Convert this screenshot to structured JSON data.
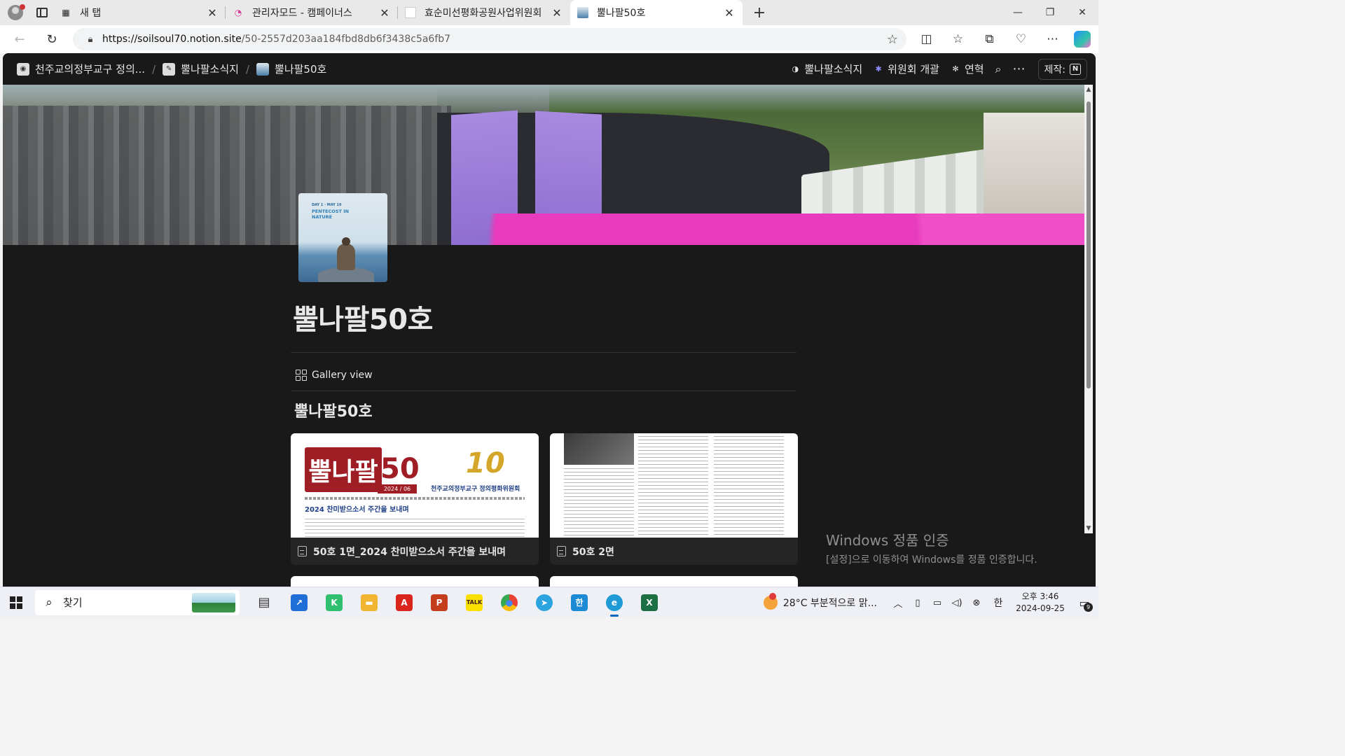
{
  "browser": {
    "tabs": [
      {
        "title": "새 탭",
        "icon": "new-tab-page-icon",
        "active": false
      },
      {
        "title": "관리자모드 - 캠페이너스",
        "icon": "campaigners-icon",
        "active": false
      },
      {
        "title": "효순미선평화공원사업위원회",
        "icon": "blank-page-icon",
        "active": false
      },
      {
        "title": "뿔나팔50호",
        "icon": "notion-page-icon",
        "active": true
      }
    ],
    "url_host": "https://soilsoul70.notion.site",
    "url_path": "/50-2557d203aa184fbd8db6f3438c5a6fb7"
  },
  "notion": {
    "breadcrumbs": [
      {
        "label": "천주교의정부교구 정의...",
        "icon": "org-logo-icon"
      },
      {
        "label": "뿔나팔소식지",
        "icon": "newsletter-icon"
      },
      {
        "label": "뿔나팔50호",
        "icon": "page-cover-icon"
      }
    ],
    "top_links": [
      {
        "label": "뿔나팔소식지",
        "icon": "newsletter-icon"
      },
      {
        "label": "위원회 개괄",
        "icon": "committee-icon"
      },
      {
        "label": "연혁",
        "icon": "history-icon"
      }
    ],
    "made_with_label": "제작:",
    "page_icon": {
      "line1": "DAY 1 · MAY 19",
      "line2": "PENTECOST IN NATURE"
    },
    "page_title": "뿔나팔50호",
    "view_label": "Gallery view",
    "database_title": "뿔나팔50호",
    "cards": [
      {
        "title": "50호 1면_2024 찬미받으소서 주간을 보내며",
        "thumb": {
          "logo_text": "뿔나팔",
          "issue": "50",
          "date": "2024 / 06",
          "org": "천주교의정부교구 정의평화위원회",
          "headline": "2024 찬미받으소서 주간을 보내며"
        }
      },
      {
        "title": "50호 2면"
      }
    ]
  },
  "watermark": {
    "line1": "Windows 정품 인증",
    "line2": "[설정]으로 이동하여 Windows를 정품 인증합니다."
  },
  "taskbar": {
    "search_placeholder": "찾기",
    "apps": [
      {
        "name": "task-view-icon",
        "glyph": "▤",
        "color": "#333333"
      },
      {
        "name": "pinned-app-icon",
        "glyph": "↗",
        "color": "#1f6fd6"
      },
      {
        "name": "kinemaster-icon",
        "glyph": "K",
        "color": "#2fbf6f"
      },
      {
        "name": "file-explorer-icon",
        "glyph": "▬",
        "color": "#f2b531"
      },
      {
        "name": "acrobat-icon",
        "glyph": "A",
        "color": "#d9251c"
      },
      {
        "name": "powerpoint-icon",
        "glyph": "P",
        "color": "#c43e1c"
      },
      {
        "name": "kakaotalk-icon",
        "glyph": "TALK",
        "color": "#f9e000"
      },
      {
        "name": "chrome-icon",
        "glyph": "●",
        "color": "#ea4335"
      },
      {
        "name": "telegram-icon",
        "glyph": "➤",
        "color": "#2aa3df"
      },
      {
        "name": "hangul-icon",
        "glyph": "한",
        "color": "#1c8ad4"
      },
      {
        "name": "edge-icon",
        "glyph": "e",
        "color": "#1e9ad6"
      },
      {
        "name": "excel-icon",
        "glyph": "X",
        "color": "#1d7044"
      }
    ],
    "weather": "28°C  부분적으로 맑...",
    "ime": "한",
    "time": "오후 3:46",
    "date": "2024-09-25",
    "notification_count": "9"
  }
}
